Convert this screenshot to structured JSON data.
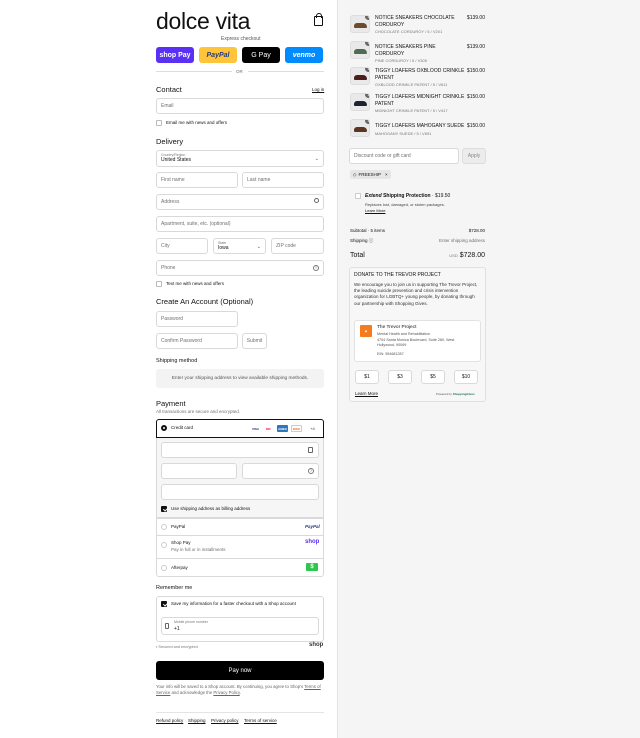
{
  "brand": {
    "logo": "dolce vita"
  },
  "express": {
    "label": "Express checkout",
    "buttons": [
      {
        "label": "shop Pay"
      },
      {
        "label": "PayPal"
      },
      {
        "label": "G Pay"
      },
      {
        "label": "venmo"
      }
    ],
    "or": "OR"
  },
  "contact": {
    "heading": "Contact",
    "login": "Log in",
    "email_placeholder": "Email",
    "news_label": "Email me with news and offers"
  },
  "delivery": {
    "heading": "Delivery",
    "country_label": "Country/Region",
    "country_value": "United States",
    "first_name": "First name",
    "last_name": "Last name",
    "address": "Address",
    "apartment": "Apartment, suite, etc. (optional)",
    "city": "City",
    "state_label": "State",
    "state_value": "Iowa",
    "zip": "ZIP code",
    "phone": "Phone",
    "text_label": "Text me with news and offers"
  },
  "account": {
    "heading": "Create An Account (Optional)",
    "password": "Password",
    "confirm": "Confirm Password",
    "submit": "Submit"
  },
  "shipping": {
    "heading": "Shipping method",
    "message": "Enter your shipping address to view available shipping methods."
  },
  "payment": {
    "heading": "Payment",
    "subtitle": "All transactions are secure and encrypted.",
    "credit_card": "Credit card",
    "card_brands": [
      "VISA",
      "MC",
      "AMEX",
      "DISC",
      "+4"
    ],
    "billing_label": "Use shipping address as billing address",
    "paypal": "PayPal",
    "paypal_logo": "PayPal",
    "shoppay": "Shop Pay",
    "shoppay_sub": "Pay in full or in installments",
    "shoppay_logo": "shop",
    "afterpay": "Afterpay",
    "afterpay_logo": "$"
  },
  "remember": {
    "heading": "Remember me",
    "save_label": "Save my information for a faster checkout with a Shop account",
    "mobile_label": "Mobile phone number",
    "mobile_value": "+1",
    "secure": "Secured and encrypted",
    "shop_logo": "shop"
  },
  "pay_now": "Pay now",
  "legal": {
    "line1": "Your info will be saved to a Shop account. By continuing, you agree to Shop's",
    "tos": "Terms of Service",
    "and": " and acknowledge the ",
    "privacy": "Privacy Policy",
    "end": "."
  },
  "footer": [
    "Refund policy",
    "Shipping",
    "Privacy policy",
    "Terms of service"
  ],
  "cart": {
    "items": [
      {
        "name": "NOTICE SNEAKERS CHOCOLATE CORDUROY",
        "variant": "CHOCOLATE CORDUROY / 5 / V201",
        "price": "$139.00",
        "qty": "1",
        "color": "#6b4a2e"
      },
      {
        "name": "NOTICE SNEAKERS PINE CORDUROY",
        "variant": "PINE CORDUROY / 5 / V305",
        "price": "$139.00",
        "qty": "1",
        "color": "#4f6b54"
      },
      {
        "name": "TIGGY LOAFERS OXBLOOD CRINKLE PATENT",
        "variant": "OXBLOOD CRINKLE PATENT / 5 / V611",
        "price": "$150.00",
        "qty": "1",
        "color": "#4a1c1c"
      },
      {
        "name": "TIGGY LOAFERS MIDNIGHT CRINKLE PATENT",
        "variant": "MIDNIGHT CRINKLE PATENT / 5 / V417",
        "price": "$150.00",
        "qty": "1",
        "color": "#1e2230"
      },
      {
        "name": "TIGGY LOAFERS MAHOGANY SUEDE",
        "variant": "MAHOGANY SUEDE / 5 / V691",
        "price": "$150.00",
        "qty": "1",
        "color": "#5a3520"
      }
    ],
    "discount_placeholder": "Discount code or gift card",
    "apply": "Apply",
    "tag": "FREESHIP",
    "extend_brand": "Extend",
    "extend_title": "Shipping Protection",
    "extend_price": "· $19.50",
    "extend_desc": "Replaces lost, damaged, or stolen packages.",
    "extend_learn": "Learn More",
    "subtotal_label": "Subtotal · 5 items",
    "subtotal_value": "$728.00",
    "shipping_label": "Shipping",
    "shipping_value": "Enter shipping address",
    "total_label": "Total",
    "total_currency": "USD",
    "total_value": "$728.00"
  },
  "donate": {
    "heading": "DONATE TO THE TREVOR PROJECT",
    "body": "We encourage you to join us in supporting The Trevor Project, the leading suicide prevention and crisis intervention organization for LGBTQ+ young people, by donating through our partnership with Shopping Gives.",
    "org_name": "The Trevor Project",
    "org_type": "Mental Health and Rehabilitation",
    "org_addr": "4704 Santa Monica Boulevard, Suite 280, West Hollywood, 90069",
    "org_ein": "EIN: 954681287",
    "amounts": [
      "$1",
      "$3",
      "$5",
      "$10"
    ],
    "learn_more": "Learn More",
    "powered": "Powered by",
    "powered_brand": "ShoppingGives"
  },
  "colors": {
    "shoppay": "#5a31f4",
    "paypal": "#ffc439",
    "gpay": "#000000",
    "venmo": "#008cff",
    "afterpay": "#b2fce4"
  }
}
